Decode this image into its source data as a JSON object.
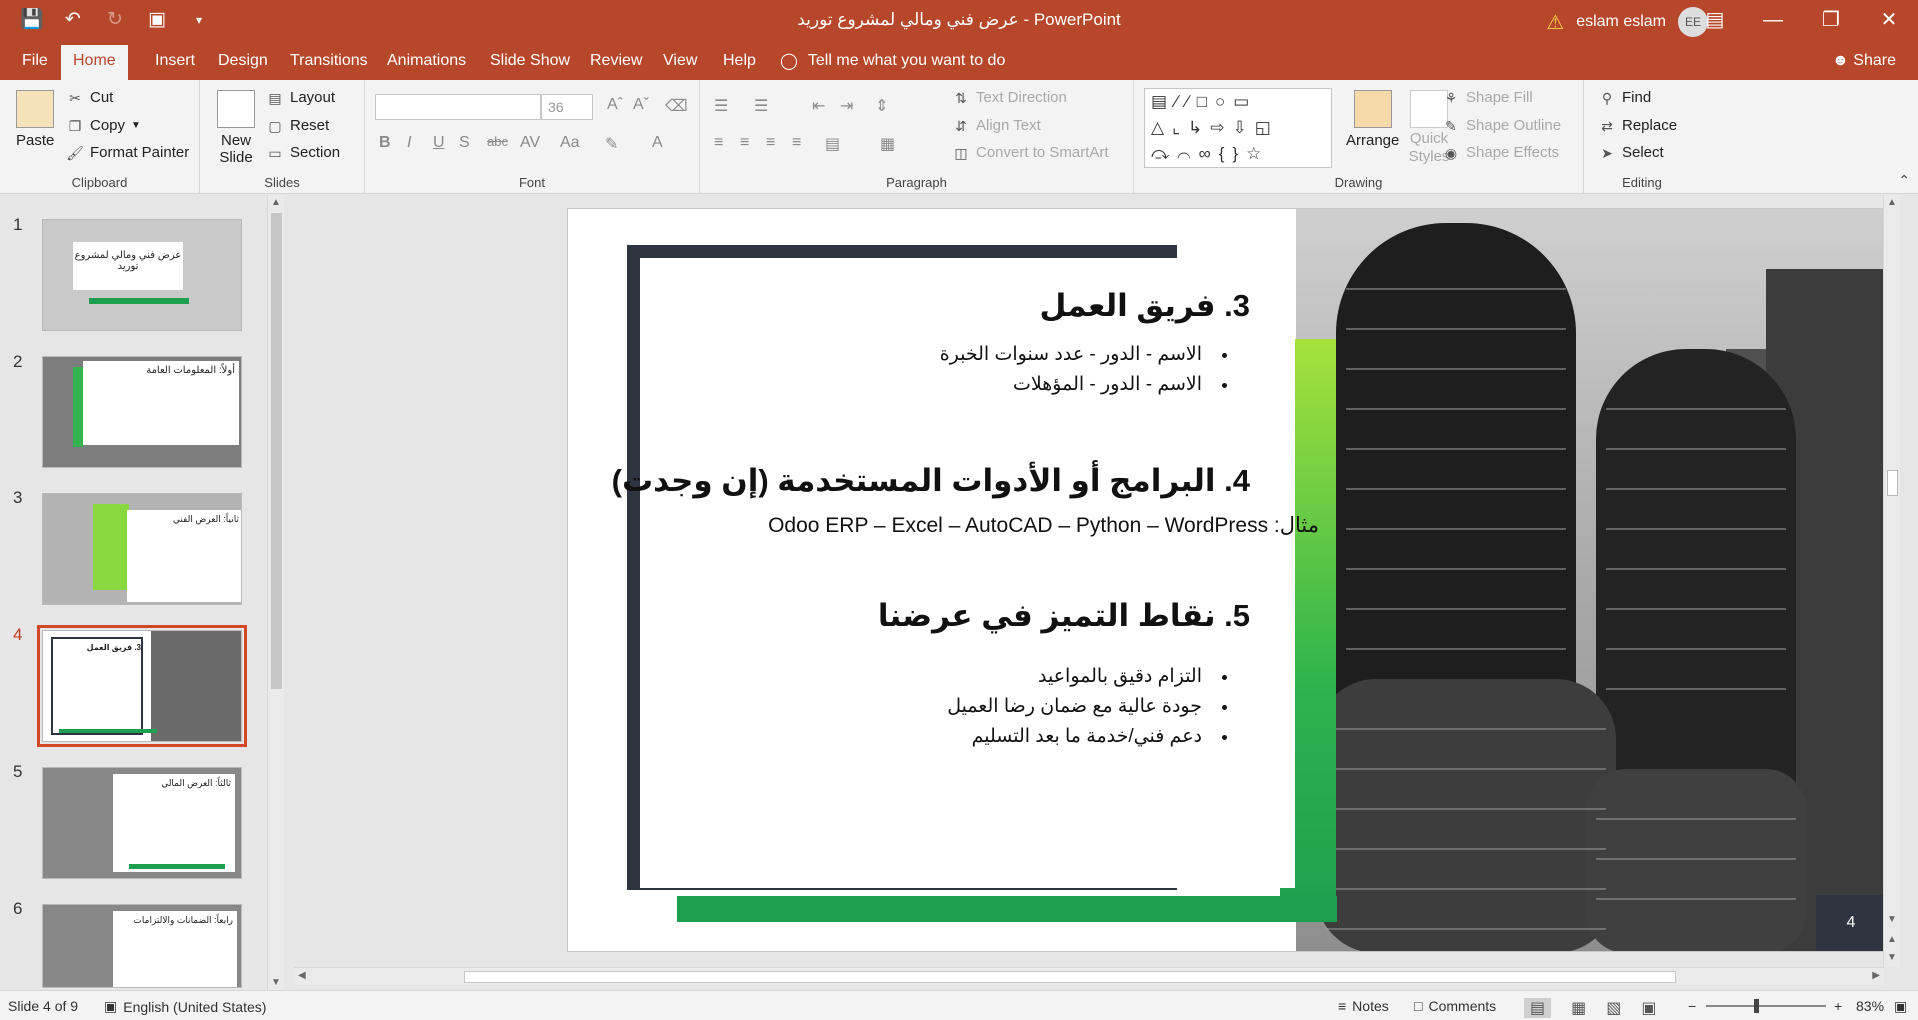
{
  "titlebar": {
    "doc_title": "عرض فني ومالي  لمشروع توريد  -  PowerPoint",
    "user": "eslam eslam",
    "initials": "EE"
  },
  "tabs": [
    {
      "label": "File"
    },
    {
      "label": "Home"
    },
    {
      "label": "Insert"
    },
    {
      "label": "Design"
    },
    {
      "label": "Transitions"
    },
    {
      "label": "Animations"
    },
    {
      "label": "Slide Show"
    },
    {
      "label": "Review"
    },
    {
      "label": "View"
    },
    {
      "label": "Help"
    }
  ],
  "tell_me": "Tell me what you want to do",
  "share": "Share",
  "ribbon": {
    "clipboard": {
      "paste": "Paste",
      "cut": "Cut",
      "copy": "Copy",
      "format_painter": "Format Painter",
      "label": "Clipboard"
    },
    "slides": {
      "new_slide": "New Slide",
      "layout": "Layout",
      "reset": "Reset",
      "section": "Section",
      "label": "Slides"
    },
    "font": {
      "size": "36",
      "label": "Font"
    },
    "paragraph": {
      "text_direction": "Text Direction",
      "align_text": "Align Text",
      "convert_smartart": "Convert to SmartArt",
      "label": "Paragraph"
    },
    "drawing": {
      "arrange": "Arrange",
      "quick_styles": "Quick Styles",
      "shape_fill": "Shape Fill",
      "shape_outline": "Shape Outline",
      "shape_effects": "Shape Effects",
      "label": "Drawing"
    },
    "editing": {
      "find": "Find",
      "replace": "Replace",
      "select": "Select",
      "label": "Editing"
    }
  },
  "thumbnails": [
    {
      "num": "1",
      "text": "عرض فني ومالي  لمشروع توريد"
    },
    {
      "num": "2",
      "text": "أولاً: المعلومات العامة"
    },
    {
      "num": "3",
      "text": "ثانياً: العرض الفني"
    },
    {
      "num": "4",
      "text": "3. فريق العمل"
    },
    {
      "num": "5",
      "text": "ثالثاً: العرض المالي"
    },
    {
      "num": "6",
      "text": "رابعاً: الضمانات والالتزامات"
    }
  ],
  "slide": {
    "h1": "3. فريق العمل",
    "team": [
      "الاسم - الدور - عدد سنوات الخبرة",
      "الاسم - الدور - المؤهلات"
    ],
    "h2": "4. البرامج أو الأدوات المستخدمة (إن وجدت)",
    "tools": "مثال: Odoo ERP – Excel – AutoCAD – Python – WordPress",
    "h3": "5. نقاط التميز في عرضنا",
    "strengths": [
      "التزام دقيق بالمواعيد",
      "جودة عالية مع ضمان رضا العميل",
      "دعم فني/خدمة ما بعد التسليم"
    ],
    "page": "4"
  },
  "status": {
    "slide_of": "Slide 4 of 9",
    "language": "English (United States)",
    "notes": "Notes",
    "comments": "Comments",
    "zoom": "83%"
  }
}
